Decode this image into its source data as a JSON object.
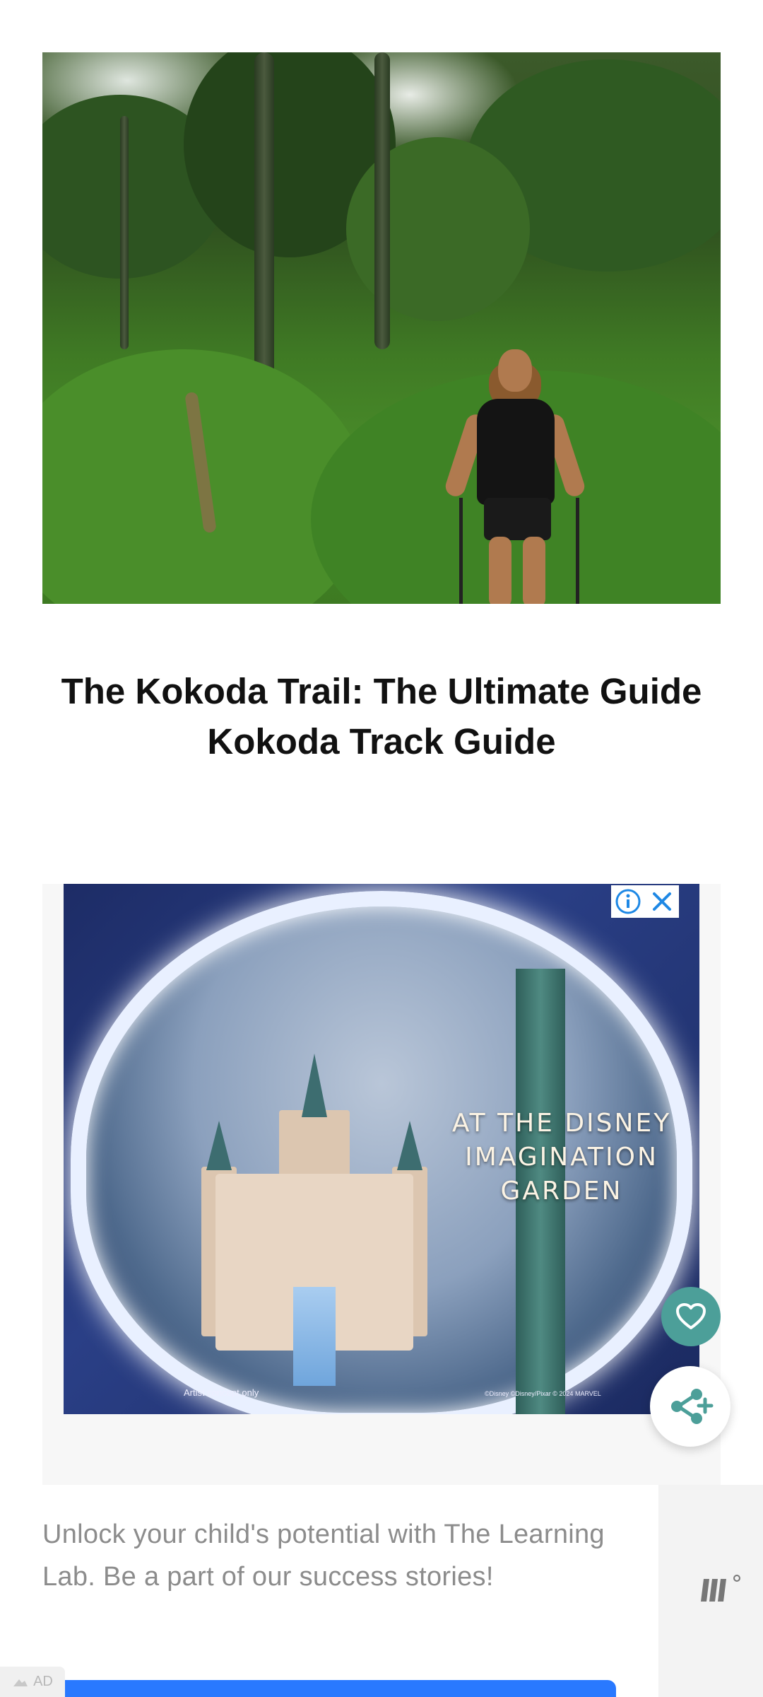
{
  "article": {
    "title_line1": "The Kokoda Trail: The Ultimate Guide",
    "title_line2": "Kokoda Track Guide"
  },
  "ad": {
    "headline_line1": "AT THE DISNEY",
    "headline_line2": "IMAGINATION",
    "headline_line3": "GARDEN",
    "fine_print_left": "Artist concept only",
    "fine_print_right": "©Disney ©Disney/Pixar © 2024 MARVEL",
    "info_icon": "info-icon",
    "close_icon": "close-icon",
    "colors": {
      "info": "#1e88e5",
      "arch_glow": "#e9f0ff"
    }
  },
  "fabs": {
    "heart_icon": "heart-icon",
    "share_icon": "share-icon",
    "color": "#4c9f99"
  },
  "promo": {
    "text": "Unlock your child's potential with The Learning Lab. Be a part of our success stories!",
    "ad_label": "AD",
    "cta_color": "#2979ff"
  }
}
